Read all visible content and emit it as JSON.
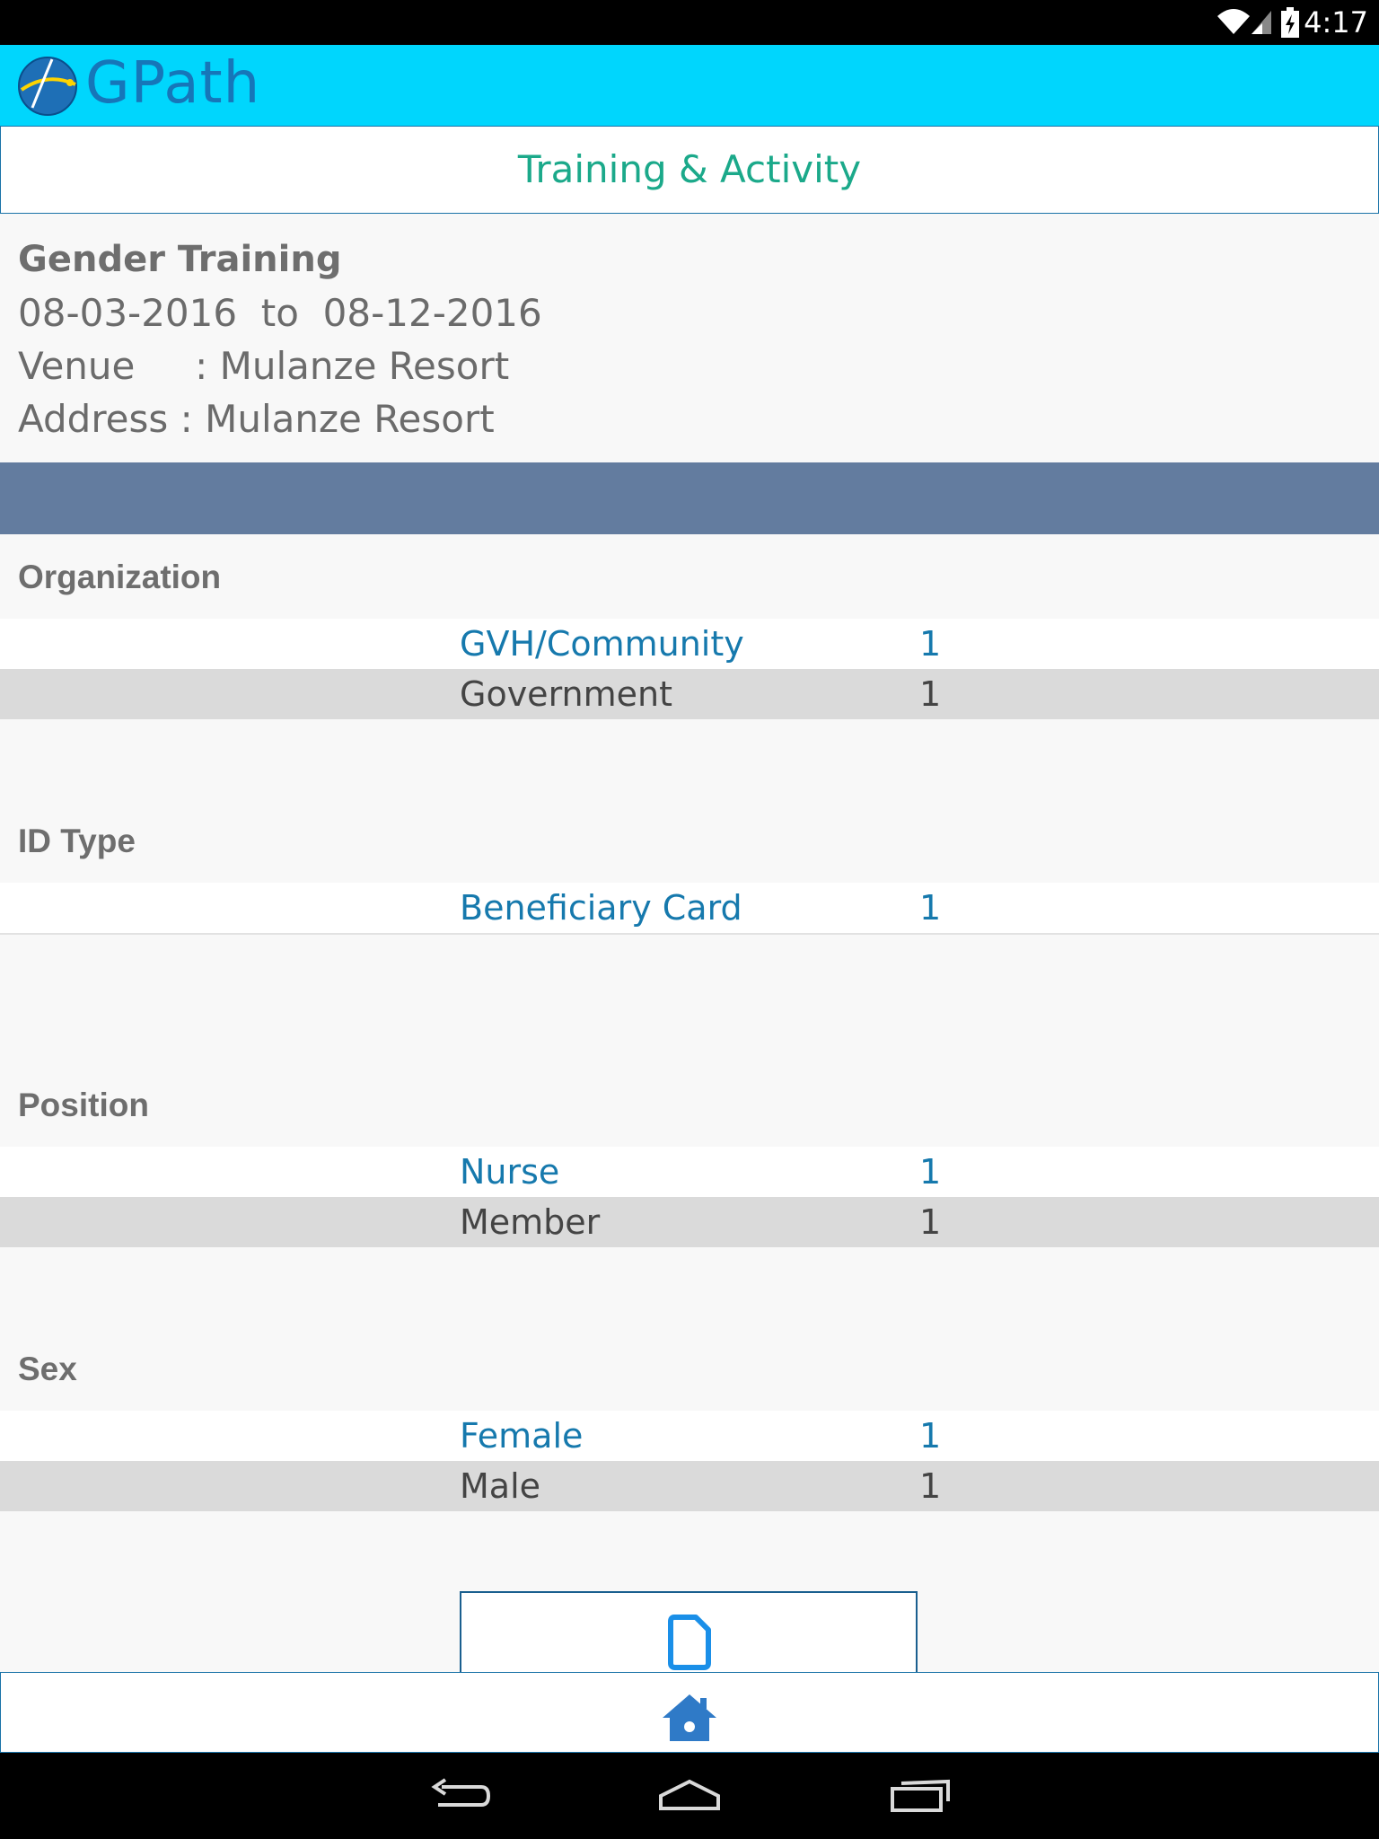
{
  "status_bar": {
    "time": "4:17",
    "icons": [
      "wifi-icon",
      "signal-icon",
      "battery-charging-icon"
    ]
  },
  "header": {
    "app_name": "GPath",
    "logo_icon": "globe-icon",
    "background_color": "#00d6fd"
  },
  "page": {
    "title": "Training & Activity"
  },
  "training": {
    "name": "Gender Training",
    "dates": "08-03-2016  to  08-12-2016",
    "venue_line": "Venue     : Mulanze Resort",
    "address_line": "Address : Mulanze Resort"
  },
  "sections": {
    "organization": {
      "title": "Organization",
      "rows": [
        {
          "label": "GVH/Community",
          "count": "1"
        },
        {
          "label": "Government",
          "count": "1"
        }
      ]
    },
    "id_type": {
      "title": "ID Type",
      "rows": [
        {
          "label": "Beneficiary Card",
          "count": "1"
        }
      ]
    },
    "position": {
      "title": "Position",
      "rows": [
        {
          "label": "Nurse",
          "count": "1"
        },
        {
          "label": "Member",
          "count": "1"
        }
      ]
    },
    "sex": {
      "title": "Sex",
      "rows": [
        {
          "label": "Female",
          "count": "1"
        },
        {
          "label": "Male",
          "count": "1"
        }
      ]
    }
  },
  "actions": {
    "export_icon": "document-icon",
    "home_icon": "home-icon"
  },
  "nav_bar": {
    "icons": [
      "back-icon",
      "home-nav-icon",
      "recent-apps-icon"
    ]
  }
}
